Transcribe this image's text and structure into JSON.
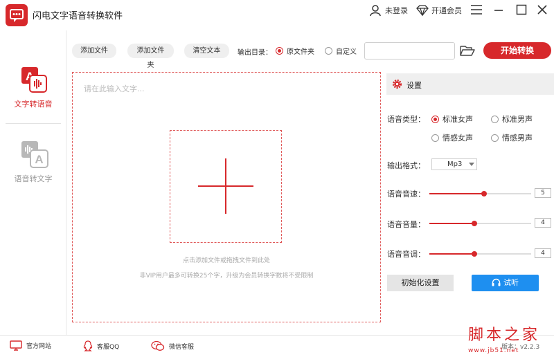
{
  "app": {
    "title": "闪电文字语音转换软件"
  },
  "titlebar": {
    "login_label": "未登录",
    "vip_label": "开通会员"
  },
  "sidebar": {
    "items": [
      {
        "label": "文字转语音",
        "active": true
      },
      {
        "label": "语音转文字",
        "active": false
      }
    ]
  },
  "toolbar": {
    "add_file": "添加文件",
    "add_folder": "添加文件夹",
    "clear_text": "清空文本",
    "output_dir_label": "输出目录：",
    "output_options": [
      "原文件夹",
      "自定义"
    ],
    "output_selected": "原文件夹",
    "path_value": "",
    "start_label": "开始转换"
  },
  "editor": {
    "placeholder": "请在此输入文字...",
    "drop_hint": "点击添加文件或拖拽文件到此处",
    "vip_hint": "非VIP用户最多可转换25个字，升级为会员转换字数将不受限制"
  },
  "settings": {
    "title": "设置",
    "voice_type_label": "语音类型：",
    "voices": [
      "标准女声",
      "标准男声",
      "情感女声",
      "情感男声"
    ],
    "voice_selected": "标准女声",
    "format_label": "输出格式：",
    "format_value": "Mp3",
    "speed": {
      "label": "语音音速：",
      "value": "5",
      "level": 0.54
    },
    "volume": {
      "label": "语音音量：",
      "value": "4",
      "level": 0.44
    },
    "pitch": {
      "label": "语音音调：",
      "value": "4",
      "level": 0.44
    },
    "reset_label": "初始化设置",
    "listen_label": "试听"
  },
  "footer": {
    "website_label": "官方网站",
    "qq_label": "客服QQ",
    "wechat_label": "微信客服",
    "version_label": "版本：v2.2.3"
  },
  "watermark": {
    "text": "脚本之家",
    "url": "www.jb51.net"
  },
  "colors": {
    "accent": "#d7282b",
    "blue": "#1e8ff0"
  }
}
